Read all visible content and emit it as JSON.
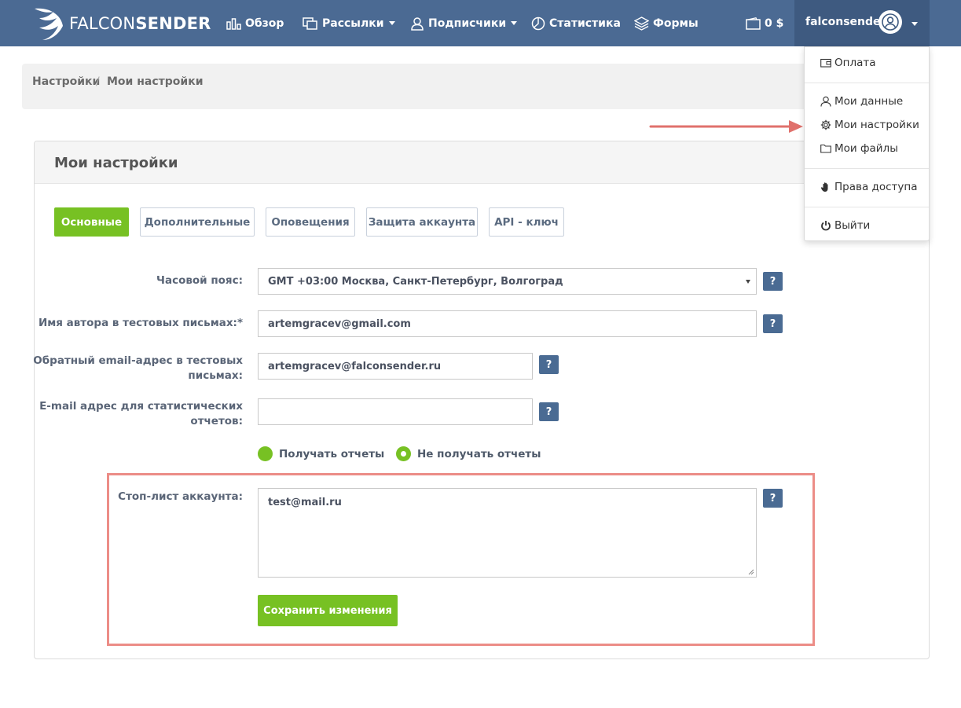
{
  "navbar": {
    "logo": {
      "thin": "FALCON",
      "bold": "SENDER"
    },
    "items": [
      {
        "label": "Обзор",
        "icon": "bar-chart-icon"
      },
      {
        "label": "Рассылки",
        "icon": "copy-icon",
        "has_caret": true
      },
      {
        "label": "Подписчики",
        "icon": "user-icon",
        "has_caret": true
      },
      {
        "label": "Статистика",
        "icon": "pie-chart-icon"
      },
      {
        "label": "Формы",
        "icon": "layers-icon"
      }
    ],
    "balance": "0 $",
    "username": "falconsender"
  },
  "breadcrumb": {
    "items": [
      "Настройки",
      "Мои настройки"
    ],
    "separator": "/"
  },
  "panel": {
    "title": "Мои настройки",
    "tabs": [
      {
        "label": "Основные",
        "active": true
      },
      {
        "label": "Дополнительные",
        "active": false
      },
      {
        "label": "Оповещения",
        "active": false
      },
      {
        "label": "Защита аккаунта",
        "active": false
      },
      {
        "label": "API - ключ",
        "active": false
      }
    ]
  },
  "form": {
    "timezone": {
      "label": "Часовой пояс:",
      "value": "GMT +03:00 Москва, Санкт-Петербург, Волгоград"
    },
    "author": {
      "label": "Имя автора в тестовых письмах:*",
      "value": "artemgracev@gmail.com"
    },
    "reply_email": {
      "label_line1": "Обратный email-адрес в тестовых",
      "label_line2": "письмах:",
      "value": "artemgracev@falconsender.ru"
    },
    "stats_email": {
      "label_line1": "E-mail адрес для статистических",
      "label_line2": "отчетов:",
      "value": ""
    },
    "reports": {
      "options": [
        {
          "label": "Получать отчеты",
          "checked": false
        },
        {
          "label": "Не получать отчеты",
          "checked": true
        }
      ]
    },
    "stoplist": {
      "label": "Стоп-лист аккаунта:",
      "value": "test@mail.ru"
    },
    "help_label": "?",
    "save_label": "Сохранить изменения"
  },
  "dropdown": {
    "items": [
      {
        "label": "Оплата",
        "icon": "wallet-icon"
      },
      {
        "label": "Мои данные",
        "icon": "user-icon"
      },
      {
        "label": "Мои настройки",
        "icon": "gear-icon"
      },
      {
        "label": "Мои файлы",
        "icon": "folder-icon"
      },
      {
        "label": "Права доступа",
        "icon": "hand-icon"
      },
      {
        "label": "Выйти",
        "icon": "power-icon"
      }
    ]
  },
  "colors": {
    "navbar": "#4b6a93",
    "accent_green": "#77c123",
    "highlight": "#ec8d87"
  }
}
